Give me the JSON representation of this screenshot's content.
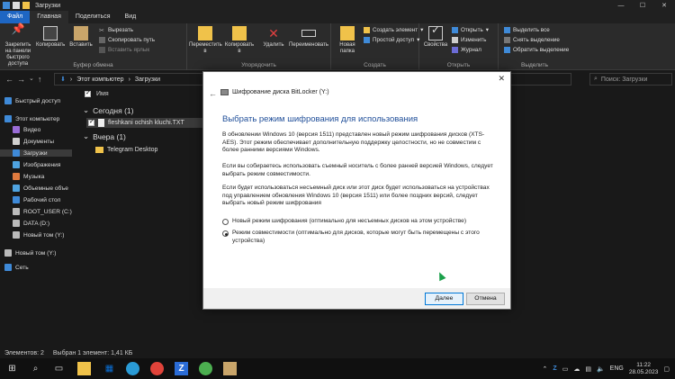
{
  "window": {
    "title": "Загрузки"
  },
  "ribbon_tabs": [
    "Файл",
    "Главная",
    "Поделиться",
    "Вид"
  ],
  "ribbon": {
    "clipboard": {
      "pin": "Закрепить на панели быстрого доступа",
      "copy": "Копировать",
      "paste": "Вставить",
      "cut": "Вырезать",
      "copy_path": "Скопировать путь",
      "paste_shortcut": "Вставить ярлык",
      "title": "Буфер обмена"
    },
    "organize": {
      "move": "Переместить в",
      "copy_to": "Копировать в",
      "delete": "Удалить",
      "rename": "Переименовать",
      "title": "Упорядочить"
    },
    "create": {
      "new_folder": "Новая папка",
      "new_item": "Создать элемент",
      "easy_access": "Простой доступ",
      "title": "Создать"
    },
    "open": {
      "properties": "Свойства",
      "open": "Открыть",
      "edit": "Изменить",
      "history": "Журнал",
      "title": "Открыть"
    },
    "select": {
      "select_all": "Выделить все",
      "select_none": "Снять выделение",
      "invert": "Обратить выделение",
      "title": "Выделить"
    }
  },
  "address": {
    "path": [
      "Этот компьютер",
      "Загрузки"
    ],
    "search_placeholder": "Поиск: Загрузки"
  },
  "nav": [
    {
      "label": "Быстрый доступ",
      "icon": "star-icon",
      "color": "#3f8ad8"
    },
    {
      "label": "Этот компьютер",
      "icon": "computer-icon",
      "color": "#3f8ad8"
    },
    {
      "label": "Видео",
      "icon": "video-icon",
      "color": "#9a6dd7"
    },
    {
      "label": "Документы",
      "icon": "document-icon",
      "color": "#d0d0d0"
    },
    {
      "label": "Загрузки",
      "icon": "download-icon",
      "color": "#3f8ad8"
    },
    {
      "label": "Изображения",
      "icon": "image-icon",
      "color": "#4fa3e0"
    },
    {
      "label": "Музыка",
      "icon": "music-icon",
      "color": "#e07b3f"
    },
    {
      "label": "Объемные объе",
      "icon": "cube-icon",
      "color": "#4fa3e0"
    },
    {
      "label": "Рабочий стол",
      "icon": "desktop-icon",
      "color": "#3f8ad8"
    },
    {
      "label": "ROOT_USER (C:)",
      "icon": "drive-icon",
      "color": "#bbbbbb"
    },
    {
      "label": "DATA (D:)",
      "icon": "drive-icon",
      "color": "#bbbbbb"
    },
    {
      "label": "Новый том (Y:)",
      "icon": "drive-icon",
      "color": "#bbbbbb"
    },
    {
      "label": "Новый том (Y:)",
      "icon": "drive-icon",
      "color": "#bbbbbb"
    },
    {
      "label": "Сеть",
      "icon": "network-icon",
      "color": "#3f8ad8"
    }
  ],
  "files": {
    "column_name": "Имя",
    "groups": [
      {
        "label": "Сегодня (1)",
        "items": [
          "fleshkani ochish kluchi.TXT"
        ]
      },
      {
        "label": "Вчера (1)",
        "items": [
          "Telegram Desktop"
        ]
      }
    ]
  },
  "status": {
    "count": "Элементов: 2",
    "selected": "Выбран 1 элемент: 1,41 КБ"
  },
  "dialog": {
    "title": "Шифрование диска BitLocker (Y:)",
    "heading": "Выбрать режим шифрования для использования",
    "p1": "В обновлении Windows 10 (версия 1511) представлен новый режим шифрования дисков (XTS-AES). Этот режим обеспечивает дополнительную поддержку целостности, но не совместим с более ранними версиями Windows.",
    "p2": "Если вы собираетесь использовать съемный носитель с более ранней версией Windows, следует выбрать режим совместимости.",
    "p3": "Если будет использоваться несъемный диск или этот диск будет использоваться на устройствах под управлением обновления Windows 10 (версия 1511) или более поздних версий, следует выбрать новый режим шифрования",
    "option_new": "Новый режим шифрования (оптимально для несъемных дисков на этом устройстве)",
    "option_compat": "Режим совместимости (оптимально для дисков, которые могут быть перемещены с этого устройства)",
    "selected": "compat",
    "next": "Далее",
    "cancel": "Отмена"
  },
  "taskbar": {
    "lang": "ENG",
    "time": "11:22",
    "date": "28.05.2023"
  }
}
